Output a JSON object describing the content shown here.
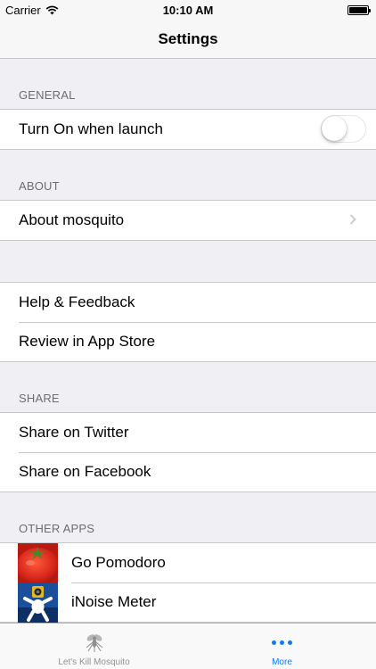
{
  "status_bar": {
    "carrier": "Carrier",
    "time": "10:10 AM"
  },
  "nav": {
    "title": "Settings"
  },
  "general": {
    "header": "GENERAL",
    "turn_on_label": "Turn On when launch",
    "turn_on_value": false
  },
  "about": {
    "header": "ABOUT",
    "about_label": "About mosquito"
  },
  "support": {
    "help_label": "Help & Feedback",
    "review_label": "Review in App Store"
  },
  "share": {
    "header": "SHARE",
    "twitter_label": "Share on Twitter",
    "facebook_label": "Share on Facebook"
  },
  "other_apps": {
    "header": "OTHER APPS",
    "items": [
      {
        "name": "Go Pomodoro",
        "icon": "tomato-app-icon"
      },
      {
        "name": "iNoise Meter",
        "icon": "noise-meter-app-icon"
      }
    ]
  },
  "tab_bar": {
    "tabs": [
      {
        "label": "Let's Kill Mosquito",
        "icon": "mosquito-icon",
        "active": false
      },
      {
        "label": "More",
        "icon": "more-dots-icon",
        "active": true
      }
    ]
  },
  "colors": {
    "tint": "#0d7bf2",
    "background": "#efeff4",
    "separator": "#c8c7cc"
  }
}
